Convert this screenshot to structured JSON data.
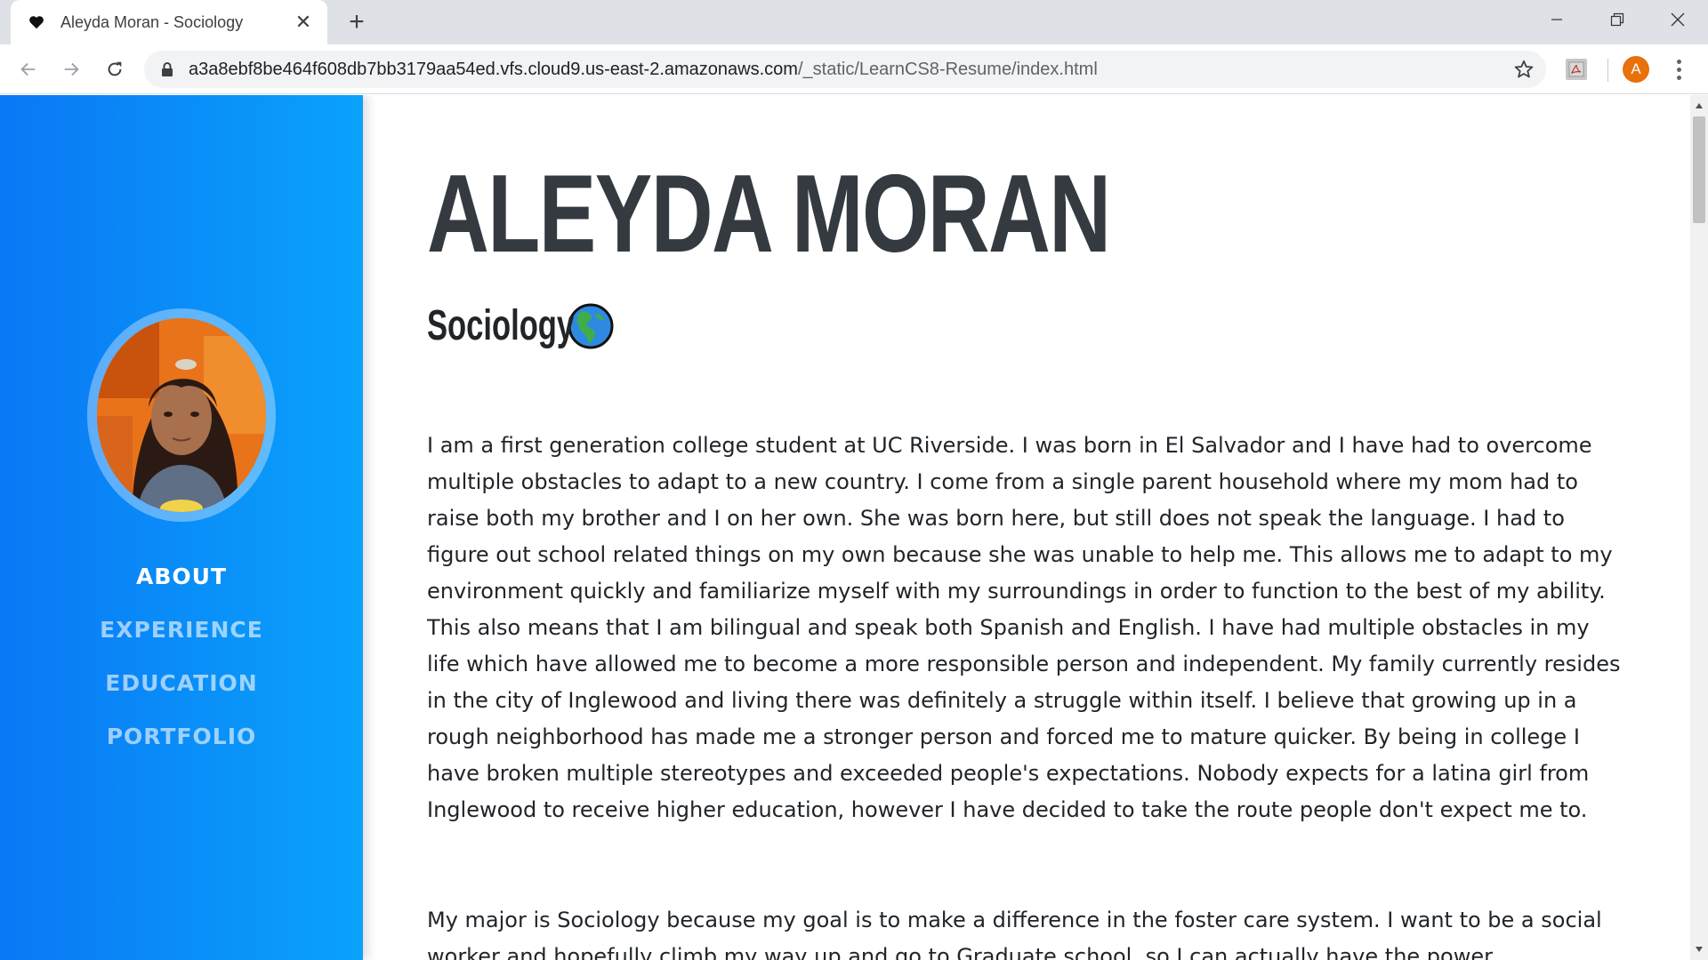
{
  "browser": {
    "tab": {
      "title": "Aleyda Moran - Sociology",
      "favicon": "heart-icon",
      "close_label": "✕"
    },
    "new_tab_label": "+",
    "url_host": "a3a8ebf8be464f608db7bb3179aa54ed.vfs.cloud9.us-east-2.amazonaws.com",
    "url_path": "/_static/LearnCS8-Resume/index.html",
    "profile_initial": "A",
    "profile_color": "#e8710a"
  },
  "sidebar": {
    "gradient_start": "#0a78f5",
    "gradient_end": "#0aa2fb",
    "nav": [
      {
        "label": "ABOUT",
        "active": true
      },
      {
        "label": "EXPERIENCE",
        "active": false
      },
      {
        "label": "EDUCATION",
        "active": false
      },
      {
        "label": "PORTFOLIO",
        "active": false
      }
    ]
  },
  "main": {
    "name": "ALEYDA MORAN",
    "subtitle": "Sociology",
    "subtitle_icon": "globe-americas-icon",
    "paragraphs": [
      "I am a first generation college student at UC Riverside. I was born in El Salvador and I have had to overcome multiple obstacles to adapt to a new country. I come from a single parent household where my mom had to raise both my brother and I on her own. She was born here, but still does not speak the language. I had to figure out school related things on my own because she was unable to help me. This allows me to adapt to my environment quickly and familiarize myself with my surroundings in order to function to the best of my ability. This also means that I am bilingual and speak both Spanish and English. I have had multiple obstacles in my life which have allowed me to become a more responsible person and independent. My family currently resides in the city of Inglewood and living there was definitely a struggle within itself. I believe that growing up in a rough neighborhood has made me a stronger person and forced me to mature quicker. By being in college I have broken multiple stereotypes and exceeded people's expectations. Nobody expects for a latina girl from Inglewood to receive higher education, however I have decided to take the route people don't expect me to.",
      "My major is Sociology because my goal is to make a difference in the foster care system. I want to be a social worker and hopefully climb my way up and go to Graduate school, so I can actually have the power"
    ]
  }
}
